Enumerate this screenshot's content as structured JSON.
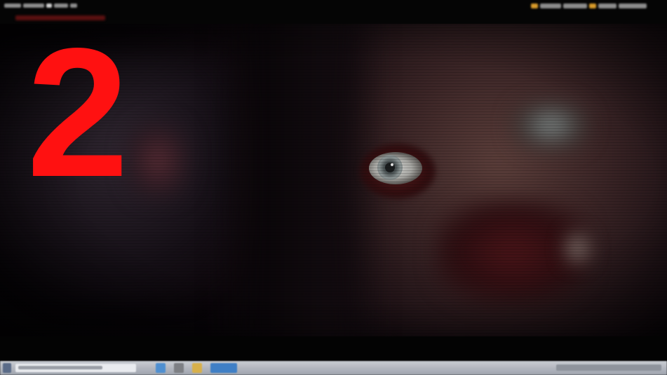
{
  "overlay": {
    "number": "2"
  },
  "colors": {
    "overlay_number": "#ff1111",
    "hud_text": "#8c8c8c",
    "hud_accent": "#d79a2a",
    "hud_subtitle": "#5a1010",
    "taskbar": "#b5b9c1"
  },
  "icons": {
    "taskbar_start": "windows-start-icon",
    "taskbar_search": "search-icon",
    "taskbar_apps": [
      "app-icon",
      "app-icon",
      "app-icon",
      "app-icon"
    ]
  }
}
